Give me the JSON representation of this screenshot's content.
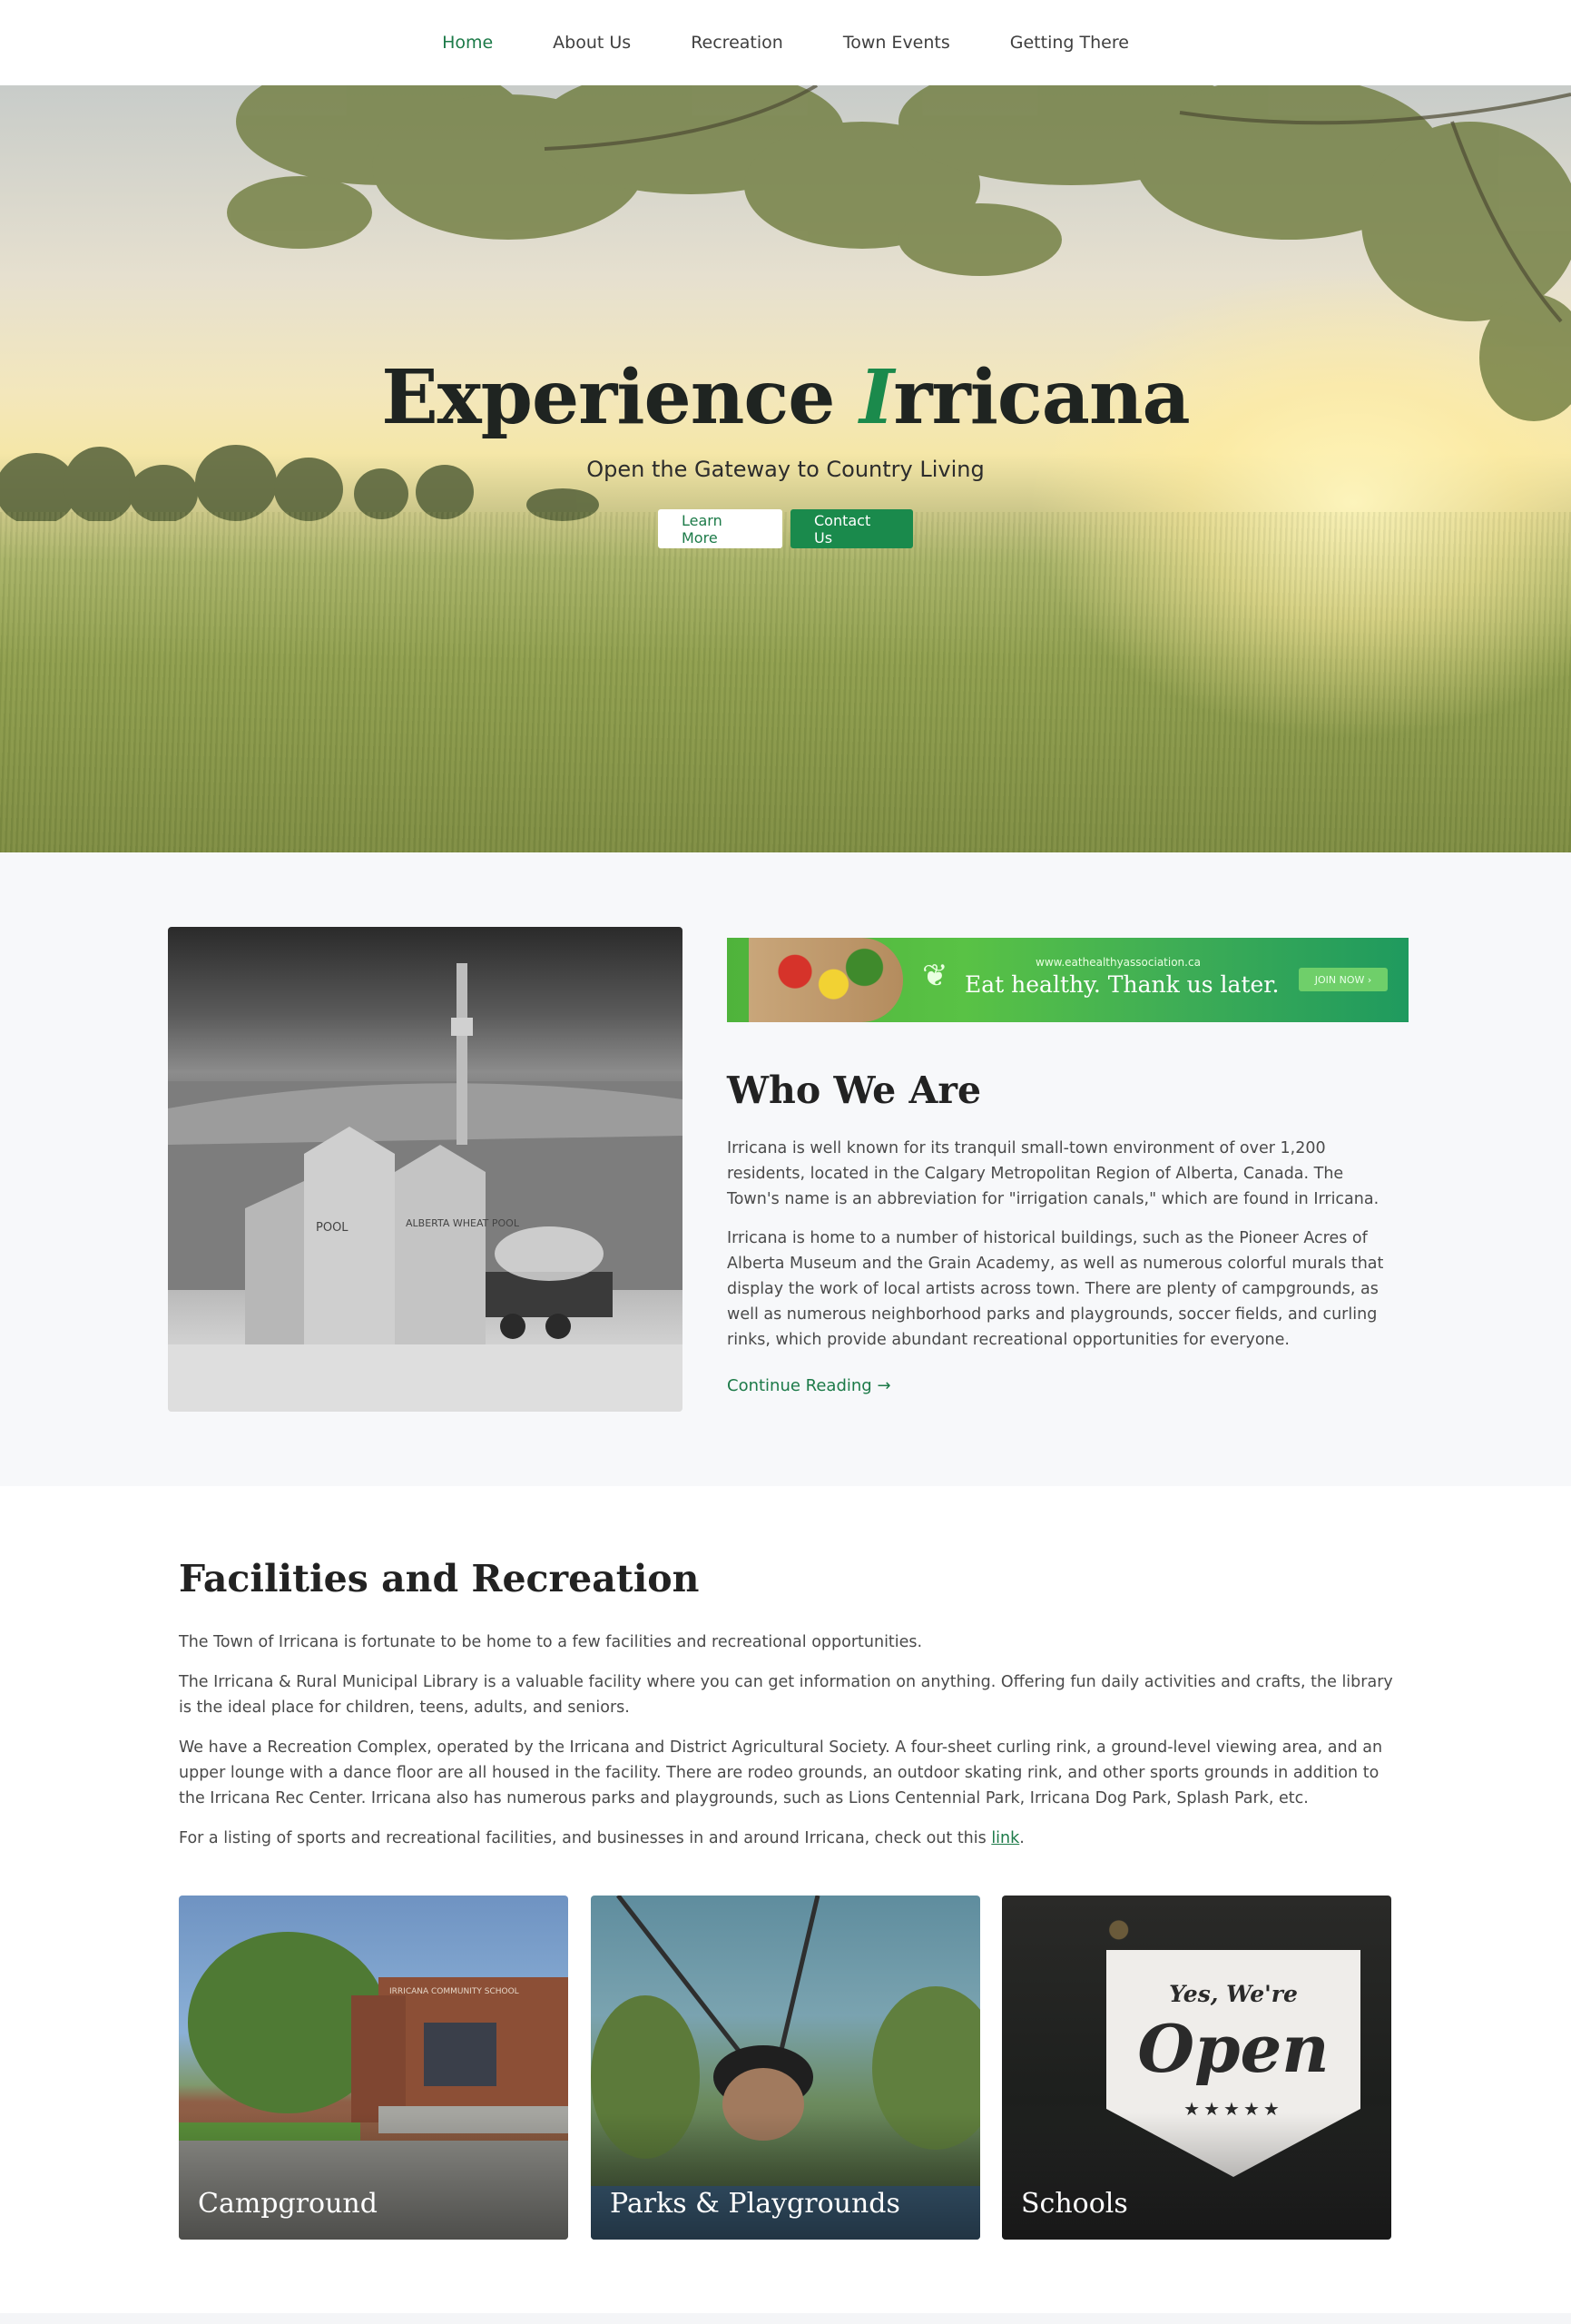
{
  "nav": {
    "items": [
      {
        "label": "Home",
        "active": true
      },
      {
        "label": "About Us",
        "active": false
      },
      {
        "label": "Recreation",
        "active": false
      },
      {
        "label": "Town Events",
        "active": false
      },
      {
        "label": "Getting There",
        "active": false
      }
    ]
  },
  "hero": {
    "title_main": "Experience ",
    "title_initial": "I",
    "title_rest": "rricana",
    "subtitle": "Open the Gateway to Country Living",
    "learn_more": "Learn More",
    "contact_us": "Contact Us"
  },
  "banner": {
    "url": "www.eathealthyassociation.ca",
    "tagline": "Eat healthy. Thank us later.",
    "cta": "JOIN NOW ›"
  },
  "who": {
    "title": "Who We Are",
    "p1": "Irricana is well known for its tranquil small-town environment of over 1,200 residents, located in the Calgary Metropolitan Region of Alberta, Canada. The Town's name is an abbreviation for \"irrigation canals,\" which are found in Irricana.",
    "p2": "Irricana is home to a number of historical buildings, such as the Pioneer Acres of Alberta Museum and the Grain Academy, as well as numerous colorful murals that display the work of local artists across town. There are plenty of campgrounds, as well as numerous neighborhood parks and playgrounds, soccer fields, and curling rinks, which provide abundant recreational opportunities for everyone.",
    "continue": "Continue Reading →"
  },
  "facilities": {
    "title": "Facilities and Recreation",
    "p1": "The Town of Irricana is fortunate to be home to a few facilities and recreational opportunities.",
    "p2": "The Irricana & Rural Municipal Library is a valuable facility where you can get information on anything. Offering fun daily activities and crafts, the library is the ideal place for children, teens, adults, and seniors.",
    "p3": "We have a Recreation Complex, operated by the Irricana and District Agricultural Society. A four-sheet curling rink, a ground-level viewing area, and an upper lounge with a dance floor are all housed in the facility. There are rodeo grounds, an outdoor skating rink, and other sports grounds in addition to the Irricana Rec Center. Irricana also has numerous parks and playgrounds, such as Lions Centennial Park, Irricana Dog Park, Splash Park, etc.",
    "p4_before": "For a listing of sports and recreational facilities, and businesses in and around Irricana, check out this ",
    "p4_link": "link",
    "p4_after": "."
  },
  "cards": [
    {
      "caption": "Campground"
    },
    {
      "caption": "Parks & Playgrounds"
    },
    {
      "caption": "Schools"
    }
  ],
  "mural_text": {
    "pool": "POOL",
    "sign": "ALBERTA WHEAT POOL"
  },
  "sign_text": {
    "yes": "Yes, We're",
    "open": "Open",
    "stars": "★★★★★"
  },
  "school_sign": "IRRICANA COMMUNITY SCHOOL",
  "colors": {
    "accent": "#1a8a4c",
    "nav_active": "#1c7a48",
    "section_bg": "#f7f8fa"
  }
}
